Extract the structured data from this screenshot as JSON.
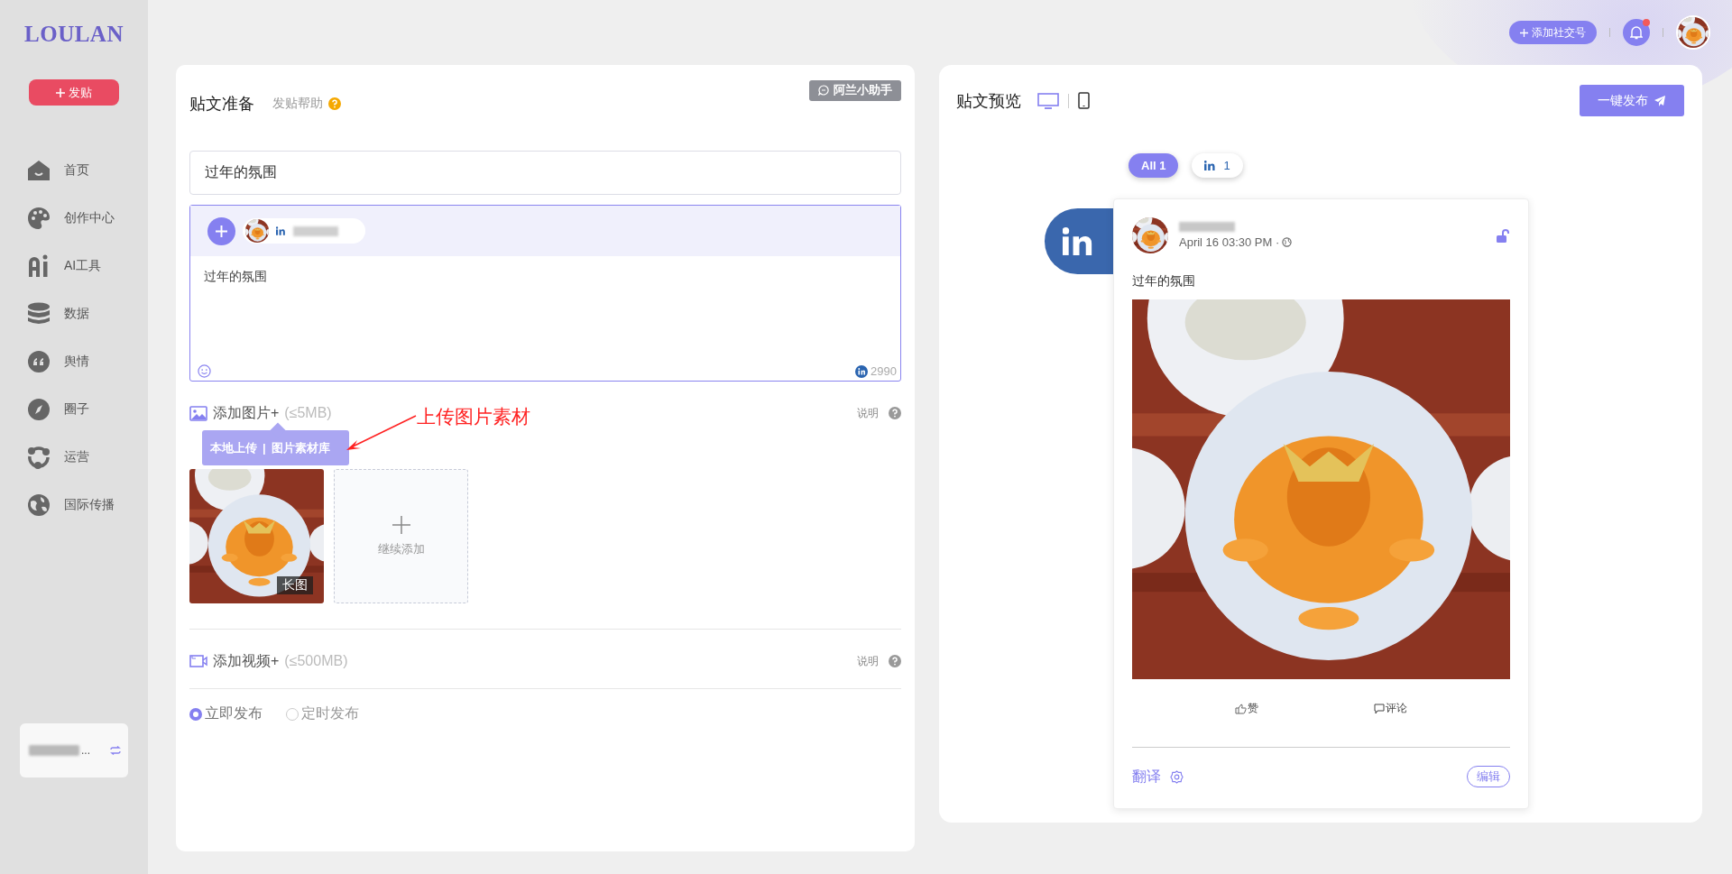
{
  "sidebar": {
    "logo": "LOULAN",
    "post_button": "发贴",
    "nav": [
      {
        "kind": "home",
        "label": "首页"
      },
      {
        "kind": "palette",
        "label": "创作中心"
      },
      {
        "kind": "ai",
        "label": "AI工具"
      },
      {
        "kind": "database",
        "label": "数据"
      },
      {
        "kind": "quote",
        "label": "舆情"
      },
      {
        "kind": "compass",
        "label": "圈子"
      },
      {
        "kind": "network",
        "label": "运营"
      },
      {
        "kind": "globe",
        "label": "国际传播"
      }
    ],
    "workspace": {
      "name_tail": "..."
    }
  },
  "top_bar": {
    "add_account_button": "添加社交号",
    "notification_dot": true
  },
  "editor": {
    "title": "贴文准备",
    "help_link": "发贴帮助",
    "assistant_button": "阿兰小助手",
    "title_field": {
      "value": "过年的氛围"
    },
    "accounts": [
      {
        "kind": "linkedin"
      }
    ],
    "body": "过年的氛围",
    "char_count": "2990",
    "image_section": {
      "label": "添加图片+",
      "limit": "(≤5MB)",
      "note": "说明"
    },
    "upload_menu": {
      "items": [
        "本地上传",
        "图片素材库"
      ],
      "separator": "|"
    },
    "annotation": "上传图片素材",
    "images": [
      {
        "kind": "picture",
        "badge": "长图"
      }
    ],
    "add_more": "继续添加",
    "video_section": {
      "label": "添加视频+",
      "limit": "(≤500MB)",
      "note": "说明"
    },
    "publish_options": [
      {
        "label": "立即发布",
        "selected": true
      },
      {
        "label": "定时发布",
        "selected": false
      }
    ]
  },
  "preview": {
    "title": "贴文预览",
    "view_modes": [
      {
        "kind": "desktop",
        "selected": true
      },
      {
        "kind": "mobile",
        "selected": false
      }
    ],
    "publish_button": "一键发布",
    "filters": [
      {
        "kind": "all",
        "label": "All 1",
        "selected": true
      },
      {
        "kind": "linkedin",
        "label": "1",
        "selected": false
      }
    ],
    "post": {
      "time": "April 16 03:30 PM ·",
      "text": "过年的氛围",
      "actions": [
        {
          "kind": "like",
          "label": "赞"
        },
        {
          "kind": "comment",
          "label": "评论"
        }
      ],
      "translate": "翻译",
      "edit_button": "编辑"
    }
  }
}
